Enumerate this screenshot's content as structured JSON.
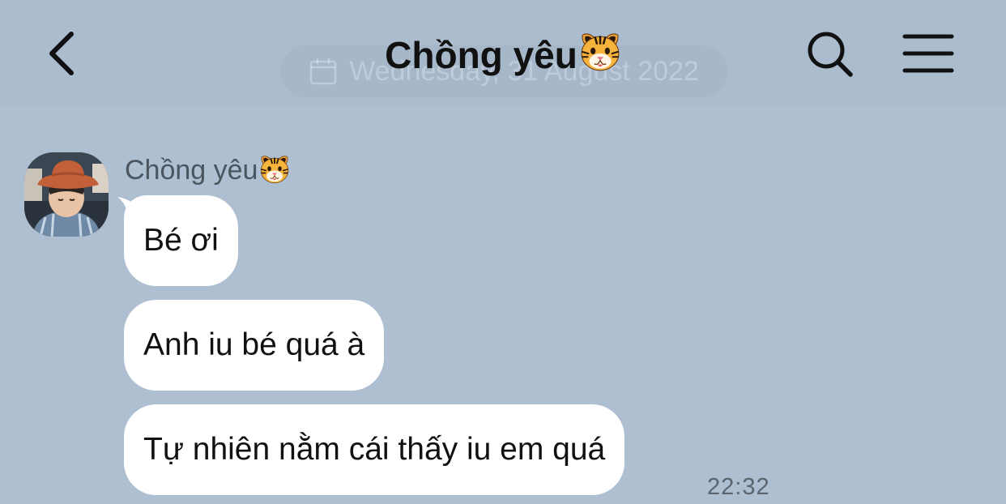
{
  "header": {
    "title": "Chồng yêu",
    "title_emoji": "tiger-face-icon",
    "date_label": "Wednesday, 31 August 2022",
    "back_icon": "chevron-left-icon",
    "search_icon": "search-icon",
    "menu_icon": "hamburger-menu-icon"
  },
  "conversation": {
    "sender_name": "Chồng yêu",
    "sender_emoji": "tiger-face-icon",
    "avatar": "avatar-photo",
    "messages": [
      {
        "text": "Bé ơi"
      },
      {
        "text": "Anh iu bé quá à"
      },
      {
        "text": "Tự nhiên nằm cái thấy iu em quá"
      }
    ],
    "timestamp": "22:32"
  },
  "colors": {
    "background": "#adbfd1",
    "header_background": "#aabcce",
    "bubble": "#ffffff",
    "text": "#111111",
    "muted_text": "#5a6570"
  }
}
